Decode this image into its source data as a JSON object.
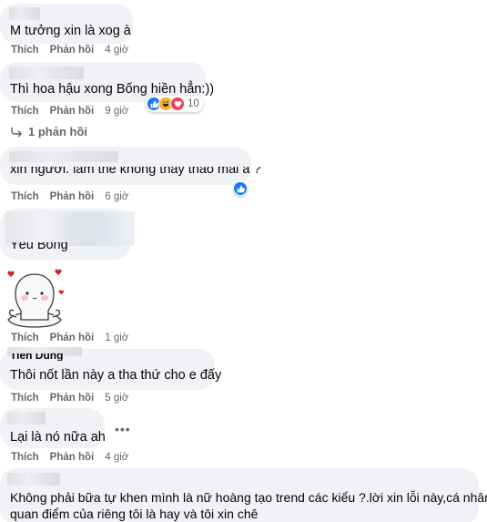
{
  "labels": {
    "like": "Thích",
    "reply": "Phản hồi"
  },
  "comments": [
    {
      "text": "M tưởng xin là xog à",
      "time": "4 giờ"
    },
    {
      "text": "Thì hoa hậu xong Bống hiền hẳn:))",
      "time": "9 giờ",
      "reaction_count": "10",
      "reactions": [
        "like-icon",
        "haha-icon",
        "love-icon"
      ]
    },
    {
      "text": "xin ngươi. làm thế không thấy thảo mai à ?",
      "time": "6 giờ",
      "reactions": [
        "like-icon"
      ]
    },
    {
      "text": "Yêu Bống",
      "time": "1 giờ"
    },
    {
      "name": "Tiến Dũng",
      "text": "Thôi nốt lần này a tha thứ cho e đấy",
      "time": "5 giờ"
    },
    {
      "text": "Lại là nó nữa ah",
      "time": "4 giờ",
      "more": "•••"
    },
    {
      "text_line1": "Không phải bữa tự khen mình là nữ hoàng tạo trend các kiểu ?.lời xin lỗi này,cá nhân",
      "text_line2": "quan điểm của riêng tôi là hay và tôi xin chê"
    }
  ],
  "view_replies": "1 phản hồi",
  "colors": {
    "bubble": "#f0f2f5",
    "meta": "#65676b",
    "like": "#1877f2",
    "love": "#f33e58",
    "haha": "#f7b125"
  }
}
